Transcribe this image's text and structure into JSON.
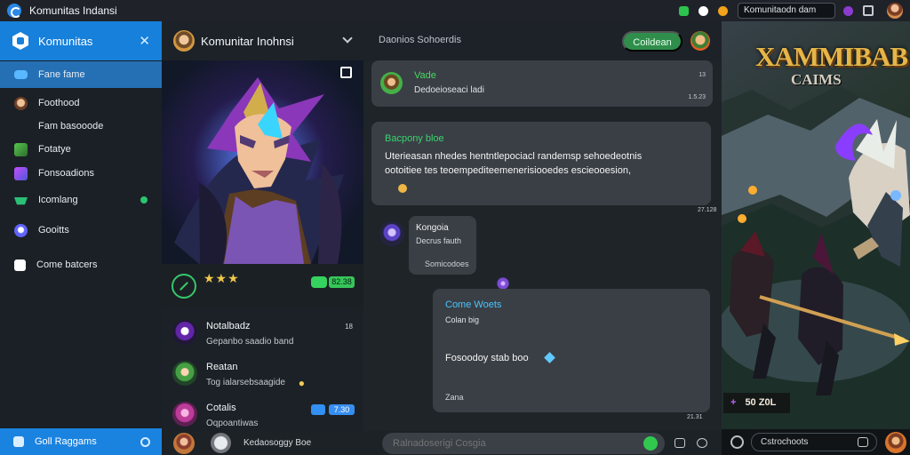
{
  "window": {
    "title": "Komunitas Indansi",
    "search_value": "Komunitaodn dam",
    "icons": [
      "app-logo-icon",
      "green-status-icon",
      "white-status-icon",
      "orange-status-icon",
      "purple-status-icon",
      "window-icon",
      "avatar"
    ]
  },
  "sidebar": {
    "title": "Komunitas",
    "items": [
      {
        "label": "Fane fame",
        "icon": "controller-icon",
        "active": true
      },
      {
        "label": "Foothood",
        "icon": "character-icon"
      },
      {
        "label": "Fam basooode",
        "icon": "text-icon"
      },
      {
        "label": "Fotatye",
        "icon": "green-game-icon"
      },
      {
        "label": "Fonsoadions",
        "icon": "purple-game-icon"
      },
      {
        "label": "Icomlang",
        "icon": "cart-icon",
        "status": "online"
      },
      {
        "label": "Gooitts",
        "icon": "profile-icon"
      },
      {
        "label": "Come batcers",
        "icon": "gift-icon"
      }
    ],
    "bottom_label": "Goll Raggams"
  },
  "header": {
    "title": "Komunitar Inohnsi",
    "subtitle": "Daonios Sohoerdis",
    "button_label": "Coildean"
  },
  "rating": {
    "stars": "★★★",
    "count": "82.38"
  },
  "list": [
    {
      "title": "Notalbadz",
      "subtitle": "Gepanbo saadio band",
      "time": "18"
    },
    {
      "title": "Reatan",
      "subtitle": "Tog ialarsebsaagide",
      "time": ""
    },
    {
      "title": "Cotalis",
      "subtitle": "Oqpoantiwas",
      "time": "",
      "count": "7.30"
    }
  ],
  "messages": [
    {
      "name": "Vade",
      "text": "Dedoeioseaci ladi",
      "time_top": "13",
      "time_bottom": "1.5.23"
    },
    {
      "title": "Bacpony bloe",
      "text": "Uterieasan nhedes hentntlepociacl randemsp sehoedeotnis ootoitiee tes teoempediteemenerisiooedes escieooesion,",
      "time": "27.128"
    },
    {
      "name": "Kongoia",
      "text": "Decrus fauth",
      "footer": "Somicodoes"
    },
    {
      "title": "Come Woets",
      "subtitle": "Colan big",
      "text": "Fosoodoy stab boo",
      "footer": "Zana",
      "time": "21.31"
    }
  ],
  "composer": {
    "sender": "Kedaosoggy Boe",
    "placeholder": "Ralnadoserigi Cosgia"
  },
  "game": {
    "title": "XAMMIBAB",
    "subtitle": "CAIMS",
    "stat": "50 Z0L",
    "input": "Cstrochoots"
  }
}
